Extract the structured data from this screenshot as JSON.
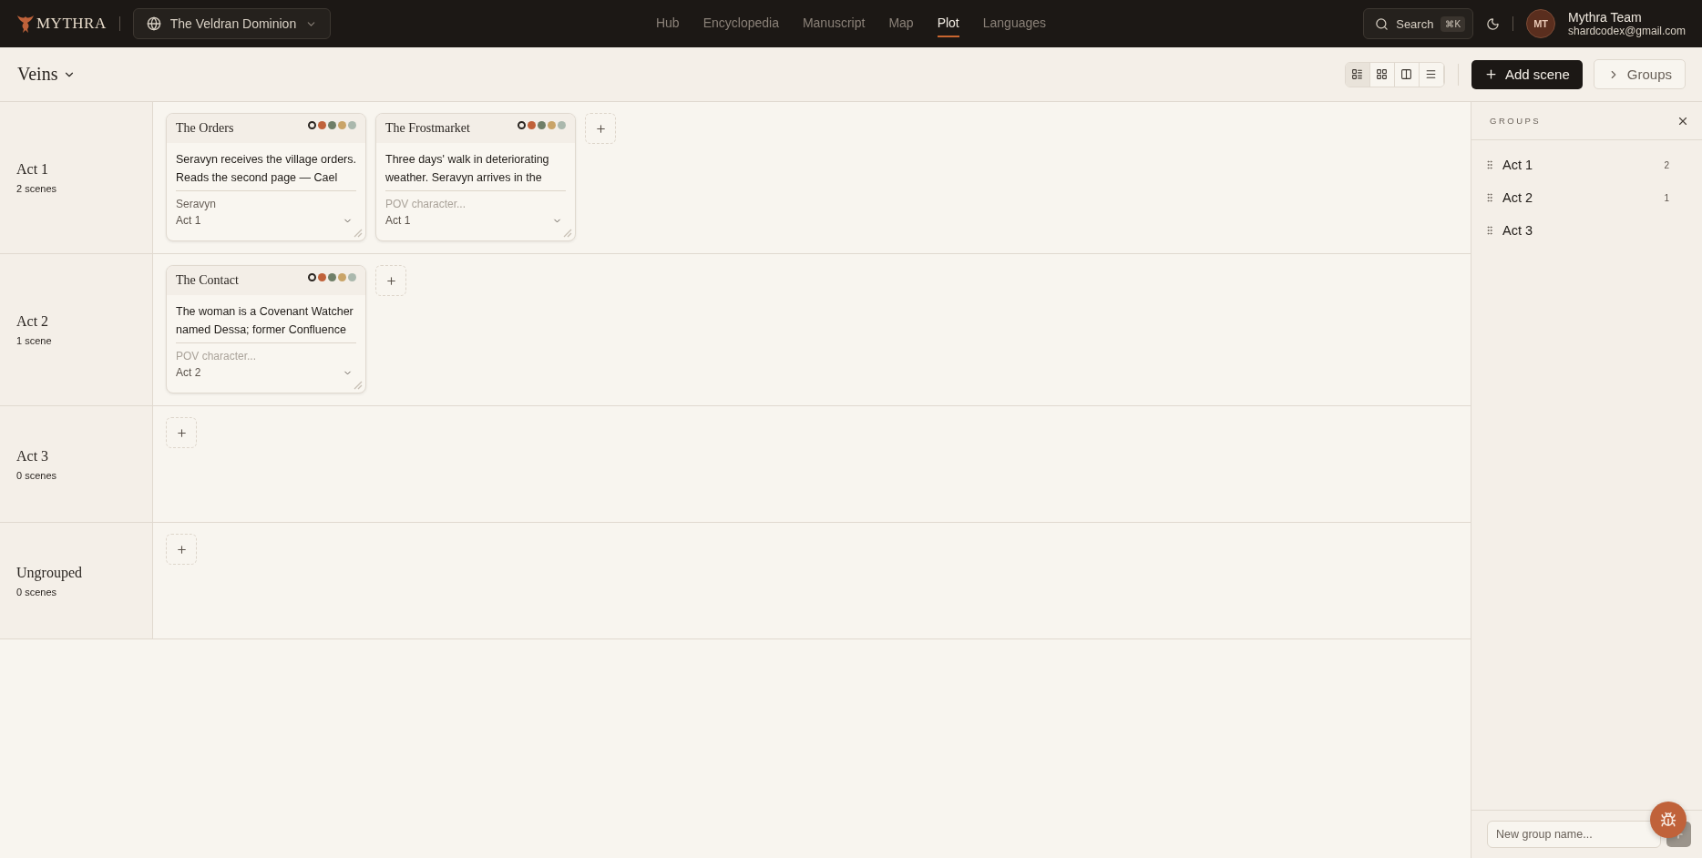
{
  "brand": {
    "name": "MYTHRA"
  },
  "world": {
    "name": "The Veldran Dominion"
  },
  "nav": [
    {
      "label": "Hub",
      "selected": false
    },
    {
      "label": "Encyclopedia",
      "selected": false
    },
    {
      "label": "Manuscript",
      "selected": false
    },
    {
      "label": "Map",
      "selected": false
    },
    {
      "label": "Plot",
      "selected": true
    },
    {
      "label": "Languages",
      "selected": false
    }
  ],
  "search": {
    "label": "Search",
    "shortcut": "⌘K"
  },
  "user": {
    "initials": "MT",
    "name": "Mythra Team",
    "email": "shardcodex@gmail.com"
  },
  "toolbar": {
    "title": "Veins",
    "views": [
      {
        "kind": "list",
        "selected": true
      },
      {
        "kind": "grid",
        "selected": false
      },
      {
        "kind": "columns",
        "selected": false
      },
      {
        "kind": "rows",
        "selected": false
      }
    ],
    "add_label": "Add scene",
    "groups_label": "Groups"
  },
  "rows": [
    {
      "title": "Act 1",
      "count": "2 scenes",
      "cards": [
        {
          "title": "The Orders",
          "summary": "Seravyn receives the village orders. Reads the second page — Cael",
          "pov": "Seravyn",
          "group": "Act 1",
          "colors": [
            {
              "color": "#2b2622",
              "selected": true
            },
            {
              "color": "#c0623a",
              "selected": false
            },
            {
              "color": "#6f7f68",
              "selected": false
            },
            {
              "color": "#c9a468",
              "selected": false
            },
            {
              "color": "#aab8ad",
              "selected": false
            }
          ]
        },
        {
          "title": "The Frostmarket",
          "summary": "Three days' walk in deteriorating weather. Seravyn arrives in the",
          "pov_placeholder": "POV character...",
          "group": "Act 1",
          "colors": [
            {
              "color": "#2b2622",
              "selected": true
            },
            {
              "color": "#c0623a",
              "selected": false
            },
            {
              "color": "#6f7f68",
              "selected": false
            },
            {
              "color": "#c9a468",
              "selected": false
            },
            {
              "color": "#aab8ad",
              "selected": false
            }
          ]
        }
      ]
    },
    {
      "title": "Act 2",
      "count": "1 scene",
      "cards": [
        {
          "title": "The Contact",
          "summary": "The woman is a Covenant Watcher named Dessa; former Confluence",
          "pov_placeholder": "POV character...",
          "group": "Act 2",
          "colors": [
            {
              "color": "#2b2622",
              "selected": true
            },
            {
              "color": "#c0623a",
              "selected": false
            },
            {
              "color": "#6f7f68",
              "selected": false
            },
            {
              "color": "#c9a468",
              "selected": false
            },
            {
              "color": "#aab8ad",
              "selected": false
            }
          ]
        }
      ]
    },
    {
      "title": "Act 3",
      "count": "0 scenes"
    },
    {
      "title": "Ungrouped",
      "count": "0 scenes"
    }
  ],
  "groups_panel": {
    "title": "GROUPS",
    "items": [
      {
        "name": "Act 1",
        "count": "2"
      },
      {
        "name": "Act 2",
        "count": "1"
      },
      {
        "name": "Act 3"
      }
    ],
    "new_placeholder": "New group name..."
  }
}
